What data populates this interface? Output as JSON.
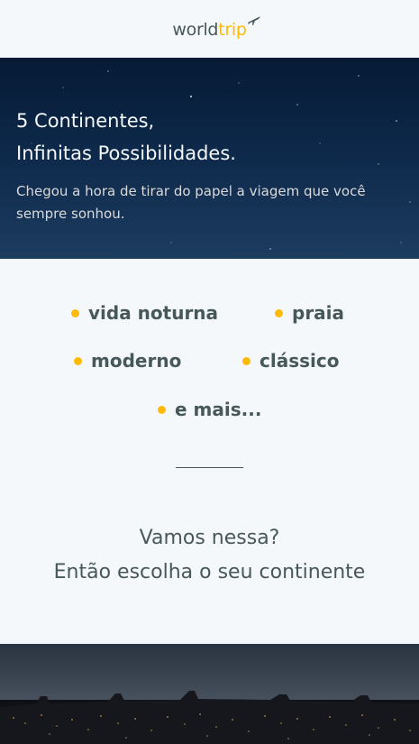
{
  "header": {
    "logo_world": "world",
    "logo_trip": "trip",
    "logo_icon": "airplane-icon"
  },
  "banner": {
    "title_line1": "5 Continentes,",
    "title_line2": "Infinitas Possibilidades.",
    "subtitle": "Chegou a hora de tirar do papel a viagem que você sempre sonhou."
  },
  "travel_types": [
    {
      "label": "vida noturna"
    },
    {
      "label": "praia"
    },
    {
      "label": "moderno"
    },
    {
      "label": "clássico"
    },
    {
      "label": "e mais..."
    }
  ],
  "cta": {
    "line1": "Vamos nessa?",
    "line2": "Então escolha o seu continente"
  },
  "colors": {
    "accent": "#ffba08",
    "text_dark": "#47585b",
    "background": "#f5f8fa",
    "banner_bg": "#0d2849"
  }
}
